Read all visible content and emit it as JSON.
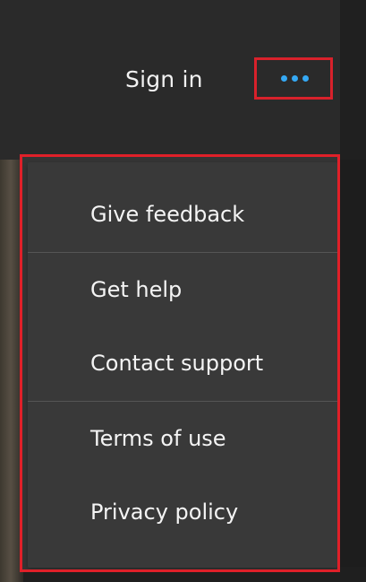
{
  "header": {
    "sign_in_label": "Sign in",
    "more_button_icon": "more-horizontal-icon",
    "accent_color": "#35a9f4",
    "highlight_color": "#d8212b"
  },
  "menu": {
    "items": [
      {
        "label": "Give feedback"
      },
      {
        "label": "Get help"
      },
      {
        "label": "Contact support"
      },
      {
        "label": "Terms of use"
      },
      {
        "label": "Privacy policy"
      }
    ]
  },
  "colors": {
    "background": "#242424",
    "menu_background": "#393939",
    "text": "#f4f4f4",
    "divider": "#555555"
  }
}
